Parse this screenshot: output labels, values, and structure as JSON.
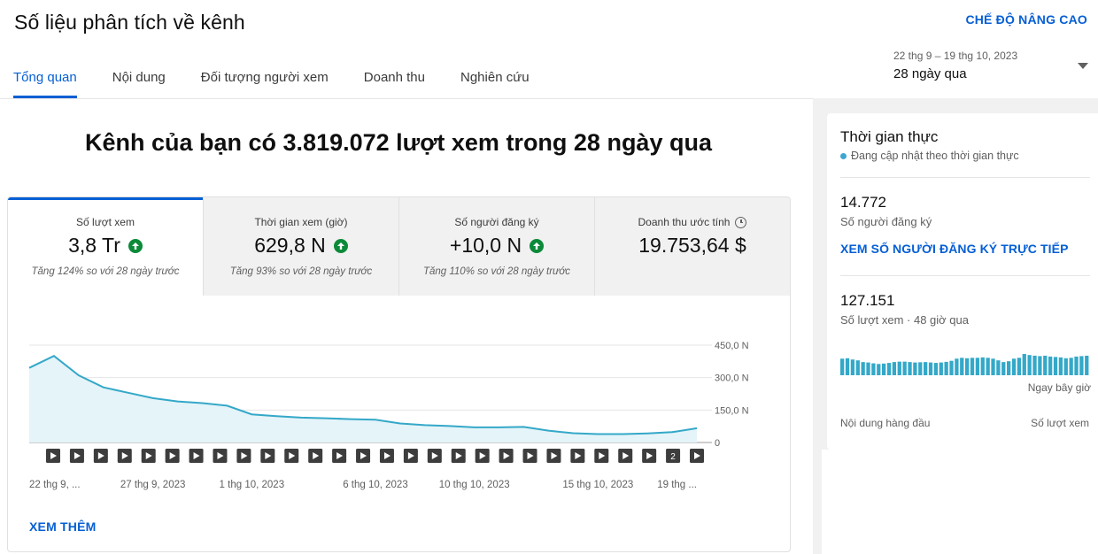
{
  "header": {
    "title": "Số liệu phân tích về kênh",
    "advanced_mode": "CHẾ ĐỘ NÂNG CAO",
    "tabs": [
      {
        "label": "Tổng quan",
        "active": true
      },
      {
        "label": "Nội dung",
        "active": false
      },
      {
        "label": "Đối tượng người xem",
        "active": false
      },
      {
        "label": "Doanh thu",
        "active": false
      },
      {
        "label": "Nghiên cứu",
        "active": false
      }
    ],
    "date_range": "22 thg 9 – 19 thg 10, 2023",
    "period_label": "28 ngày qua"
  },
  "main": {
    "heading": "Kênh của bạn có 3.819.072 lượt xem trong 28 ngày qua",
    "metrics": [
      {
        "label": "Số lượt xem",
        "value": "3,8 Tr",
        "trend": "up",
        "note": "Tăng 124% so với 28 ngày trước"
      },
      {
        "label": "Thời gian xem (giờ)",
        "value": "629,8 N",
        "trend": "up",
        "note": "Tăng 93% so với 28 ngày trước"
      },
      {
        "label": "Số người đăng ký",
        "value": "+10,0 N",
        "trend": "up",
        "note": "Tăng 110% so với 28 ngày trước"
      },
      {
        "label": "Doanh thu ước tính",
        "value": "19.753,64 $",
        "trend": "none",
        "note": ""
      }
    ],
    "see_more": "XEM THÊM"
  },
  "chart_data": {
    "type": "area",
    "x": [
      "22 thg 9",
      "23 thg 9",
      "24 thg 9",
      "25 thg 9",
      "26 thg 9",
      "27 thg 9",
      "28 thg 9",
      "29 thg 9",
      "30 thg 9",
      "1 thg 10",
      "2 thg 10",
      "3 thg 10",
      "4 thg 10",
      "5 thg 10",
      "6 thg 10",
      "7 thg 10",
      "8 thg 10",
      "9 thg 10",
      "10 thg 10",
      "11 thg 10",
      "12 thg 10",
      "13 thg 10",
      "14 thg 10",
      "15 thg 10",
      "16 thg 10",
      "17 thg 10",
      "18 thg 10",
      "19 thg 10"
    ],
    "values": [
      345000,
      400000,
      310000,
      255000,
      230000,
      205000,
      190000,
      182000,
      170000,
      130000,
      122000,
      115000,
      112000,
      108000,
      105000,
      88000,
      80000,
      76000,
      70000,
      70000,
      72000,
      55000,
      43000,
      39000,
      39000,
      42000,
      48000,
      66000
    ],
    "ylim": [
      0,
      450000
    ],
    "y_ticks": [
      {
        "value": 0,
        "label": "0"
      },
      {
        "value": 150000,
        "label": "150,0 N"
      },
      {
        "value": 300000,
        "label": "300,0 N"
      },
      {
        "value": 450000,
        "label": "450,0 N"
      }
    ],
    "x_ticks": [
      {
        "index": 0,
        "label": "22 thg 9, ..."
      },
      {
        "index": 5,
        "label": "27 thg 9, 2023"
      },
      {
        "index": 9,
        "label": "1 thg 10, 2023"
      },
      {
        "index": 14,
        "label": "6 thg 10, 2023"
      },
      {
        "index": 18,
        "label": "10 thg 10, 2023"
      },
      {
        "index": 23,
        "label": "15 thg 10, 2023"
      },
      {
        "index": 27,
        "label": "19 thg ..."
      }
    ],
    "video_markers": [
      {
        "index": 0
      },
      {
        "index": 1
      },
      {
        "index": 2
      },
      {
        "index": 3
      },
      {
        "index": 4
      },
      {
        "index": 5
      },
      {
        "index": 6
      },
      {
        "index": 7
      },
      {
        "index": 8
      },
      {
        "index": 9
      },
      {
        "index": 10
      },
      {
        "index": 11
      },
      {
        "index": 12
      },
      {
        "index": 13
      },
      {
        "index": 14
      },
      {
        "index": 15
      },
      {
        "index": 16
      },
      {
        "index": 17
      },
      {
        "index": 18
      },
      {
        "index": 19
      },
      {
        "index": 20
      },
      {
        "index": 21
      },
      {
        "index": 22
      },
      {
        "index": 23
      },
      {
        "index": 24
      },
      {
        "index": 25
      },
      {
        "index": 26,
        "count": "2"
      },
      {
        "index": 27
      }
    ],
    "grid": true,
    "line_color": "#34a8c8",
    "fill_color": "#e4f4f9"
  },
  "realtime": {
    "title": "Thời gian thực",
    "subtitle": "Đang cập nhật theo thời gian thực",
    "subscribers_value": "14.772",
    "subscribers_label": "Số người đăng ký",
    "live_subs_link": "XEM SỐ NGƯỜI ĐĂNG KÝ TRỰC TIẾP",
    "views_value": "127.151",
    "views_label": "Số lượt xem · 48 giờ qua",
    "bars": [
      0.78,
      0.8,
      0.74,
      0.7,
      0.62,
      0.6,
      0.56,
      0.53,
      0.55,
      0.58,
      0.62,
      0.64,
      0.64,
      0.62,
      0.6,
      0.61,
      0.62,
      0.6,
      0.58,
      0.6,
      0.63,
      0.68,
      0.78,
      0.82,
      0.8,
      0.82,
      0.82,
      0.84,
      0.82,
      0.78,
      0.7,
      0.62,
      0.66,
      0.78,
      0.82,
      1.0,
      0.95,
      0.92,
      0.9,
      0.92,
      0.88,
      0.86,
      0.84,
      0.8,
      0.82,
      0.88,
      0.9,
      0.92
    ],
    "bar_color": "#34a8c8",
    "now_label": "Ngay bây giờ",
    "top_content_label": "Nội dung hàng đầu",
    "top_content_metric": "Số lượt xem"
  }
}
